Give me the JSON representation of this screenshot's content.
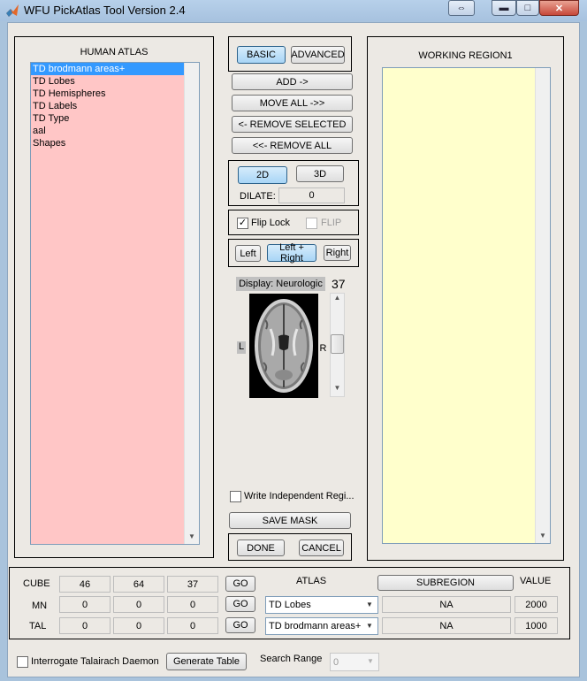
{
  "window": {
    "title": "WFU PickAtlas Tool Version 2.4"
  },
  "titlebar_icons": {
    "app": "matlab-icon",
    "expand": "expand-arrows-icon",
    "minimize": "minimize-icon",
    "maximize": "maximize-icon",
    "close": "close-icon"
  },
  "human_atlas": {
    "title": "HUMAN ATLAS",
    "items": [
      "TD brodmann areas+",
      "TD Lobes",
      "TD Hemispheres",
      "TD Labels",
      "TD Type",
      "aal",
      "Shapes"
    ],
    "selected_index": 0,
    "bg_color": "#ffc6c6"
  },
  "mode": {
    "basic": "BASIC",
    "advanced": "ADVANCED",
    "active": "BASIC"
  },
  "actions": {
    "add": "ADD ->",
    "move_all": "MOVE ALL ->>",
    "remove_selected": "<- REMOVE SELECTED",
    "remove_all": "<<- REMOVE ALL"
  },
  "view": {
    "btn_2d": "2D",
    "btn_3d": "3D",
    "active": "2D",
    "dilate_label": "DILATE:",
    "dilate_value": "0"
  },
  "flip": {
    "flip_lock": "Flip Lock",
    "flip_lock_checked": true,
    "flip": "FLIP",
    "flip_checked": false
  },
  "hemisphere": {
    "left": "Left",
    "both": "Left + Right",
    "right": "Right",
    "active": "Left + Right"
  },
  "display": {
    "label": "Display: Neurologic",
    "slice": "37",
    "left_marker": "L",
    "right_marker": "R"
  },
  "write_independent": {
    "label": "Write Independent Regi...",
    "checked": false
  },
  "save_mask": "SAVE MASK",
  "done": "DONE",
  "cancel": "CANCEL",
  "working_region": {
    "title": "WORKING REGION1",
    "items": [],
    "bg_color": "#ffffcc"
  },
  "coords": {
    "headers": {
      "atlas": "ATLAS",
      "subregion": "SUBREGION",
      "value": "VALUE"
    },
    "go": "GO",
    "rows": [
      {
        "label": "CUBE",
        "x": "46",
        "y": "64",
        "z": "37"
      },
      {
        "label": "MN",
        "x": "0",
        "y": "0",
        "z": "0",
        "atlas": "TD Lobes",
        "subregion": "NA",
        "value": "2000"
      },
      {
        "label": "TAL",
        "x": "0",
        "y": "0",
        "z": "0",
        "atlas": "TD brodmann areas+",
        "subregion": "NA",
        "value": "1000"
      }
    ]
  },
  "bottom": {
    "interrogate": "Interrogate Talairach Daemon",
    "interrogate_checked": false,
    "generate_table": "Generate Table",
    "search_range_label": "Search Range",
    "search_range_value": "0"
  }
}
